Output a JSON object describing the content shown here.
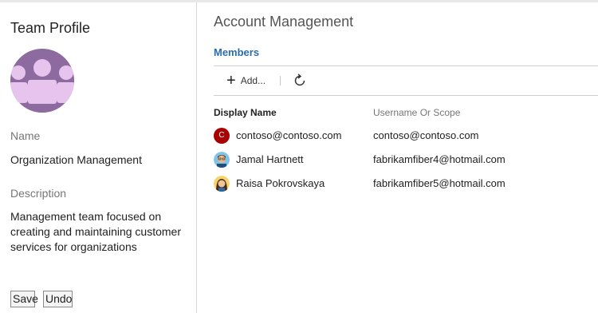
{
  "team_profile": {
    "title": "Team Profile",
    "name_label": "Name",
    "name_value": "Organization Management",
    "description_label": "Description",
    "description_value": "Management team focused on creating and maintaining customer services for organizations",
    "save_label": "Save",
    "undo_label": "Undo",
    "avatar_color": "#8d6a9f"
  },
  "account": {
    "title": "Account Management",
    "section": "Members",
    "toolbar": {
      "add_label": "Add...",
      "add_icon": "plus-icon",
      "refresh_icon": "refresh-icon"
    },
    "columns": [
      "Display Name",
      "Username Or Scope"
    ],
    "members": [
      {
        "display_name": "contoso@contoso.com",
        "username": "contoso@contoso.com",
        "avatar_initial": "C",
        "avatar_color": "#a80000"
      },
      {
        "display_name": "Jamal Hartnett",
        "username": "fabrikamfiber4@hotmail.com",
        "avatar": "male-avatar-icon"
      },
      {
        "display_name": "Raisa Pokrovskaya",
        "username": "fabrikamfiber5@hotmail.com",
        "avatar": "female-avatar-icon"
      }
    ]
  },
  "colors": {
    "link": "#2b6cb0",
    "border": "#d8d8d8"
  }
}
